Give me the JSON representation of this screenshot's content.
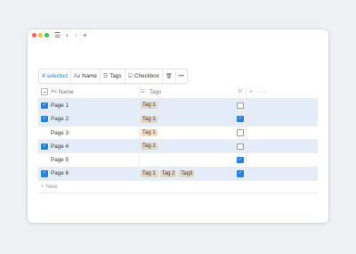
{
  "titlebar": {
    "icons": [
      "sidebar-icon",
      "back-icon",
      "forward-icon",
      "new-tab-icon"
    ]
  },
  "toolbar": {
    "selected_count": "4 selected",
    "name_label": "Name",
    "name_icon_text": "Aa",
    "tags_label": "Tags",
    "checkbox_label": "Checkbox"
  },
  "table": {
    "headers": {
      "name": "Name",
      "name_icon_text": "Aa",
      "tags": "Tags"
    },
    "rows": [
      {
        "name": "Page 1",
        "selected": true,
        "tags": [
          "Tag 1"
        ],
        "checked": false
      },
      {
        "name": "Page 2",
        "selected": true,
        "tags": [
          "Tag 1"
        ],
        "checked": true
      },
      {
        "name": "Page 3",
        "selected": false,
        "tags": [
          "Tag 1"
        ],
        "checked": false
      },
      {
        "name": "Page 4",
        "selected": true,
        "tags": [
          "Tag 1"
        ],
        "checked": false
      },
      {
        "name": "Page 5",
        "selected": false,
        "tags": [],
        "checked": true
      },
      {
        "name": "Page 6",
        "selected": true,
        "tags": [
          "Tag 1",
          "Tag 2",
          "Tag3"
        ],
        "checked": true
      }
    ],
    "new_label": "New"
  },
  "colors": {
    "accent": "#2383e2",
    "selected_row": "#e4ecfa",
    "tag": "#e3d6c8"
  }
}
